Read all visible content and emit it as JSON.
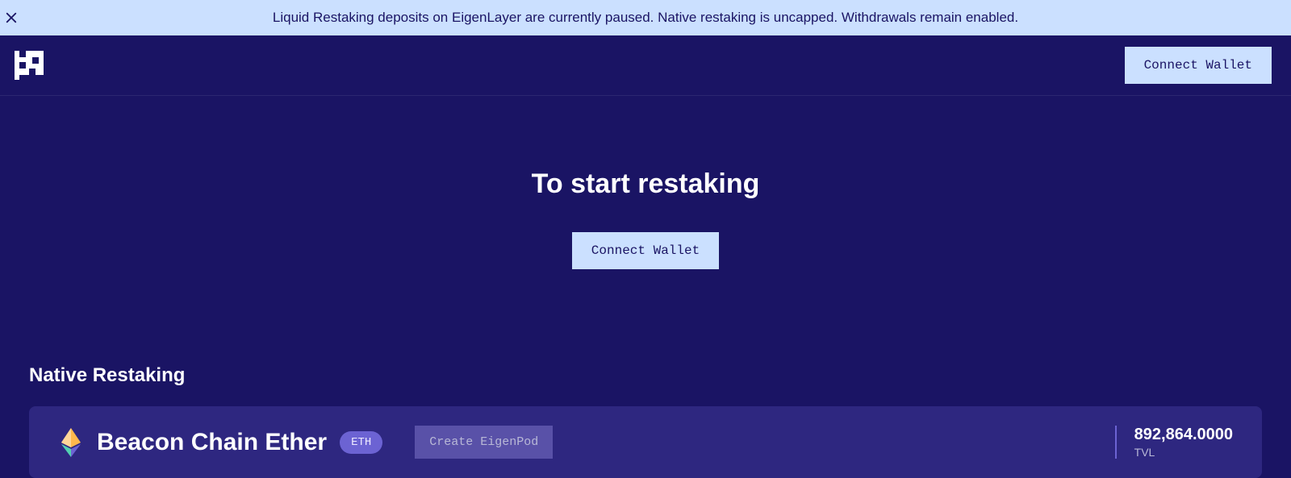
{
  "banner": {
    "text": "Liquid Restaking deposits on EigenLayer are currently paused. Native restaking is uncapped. Withdrawals remain enabled."
  },
  "header": {
    "connect_wallet": "Connect Wallet"
  },
  "main": {
    "title": "To start restaking",
    "connect_wallet": "Connect Wallet"
  },
  "section": {
    "title": "Native Restaking",
    "asset": {
      "name": "Beacon Chain Ether",
      "badge": "ETH",
      "create_button": "Create EigenPod",
      "tvl_value": "892,864.0000",
      "tvl_label": "TVL"
    }
  }
}
